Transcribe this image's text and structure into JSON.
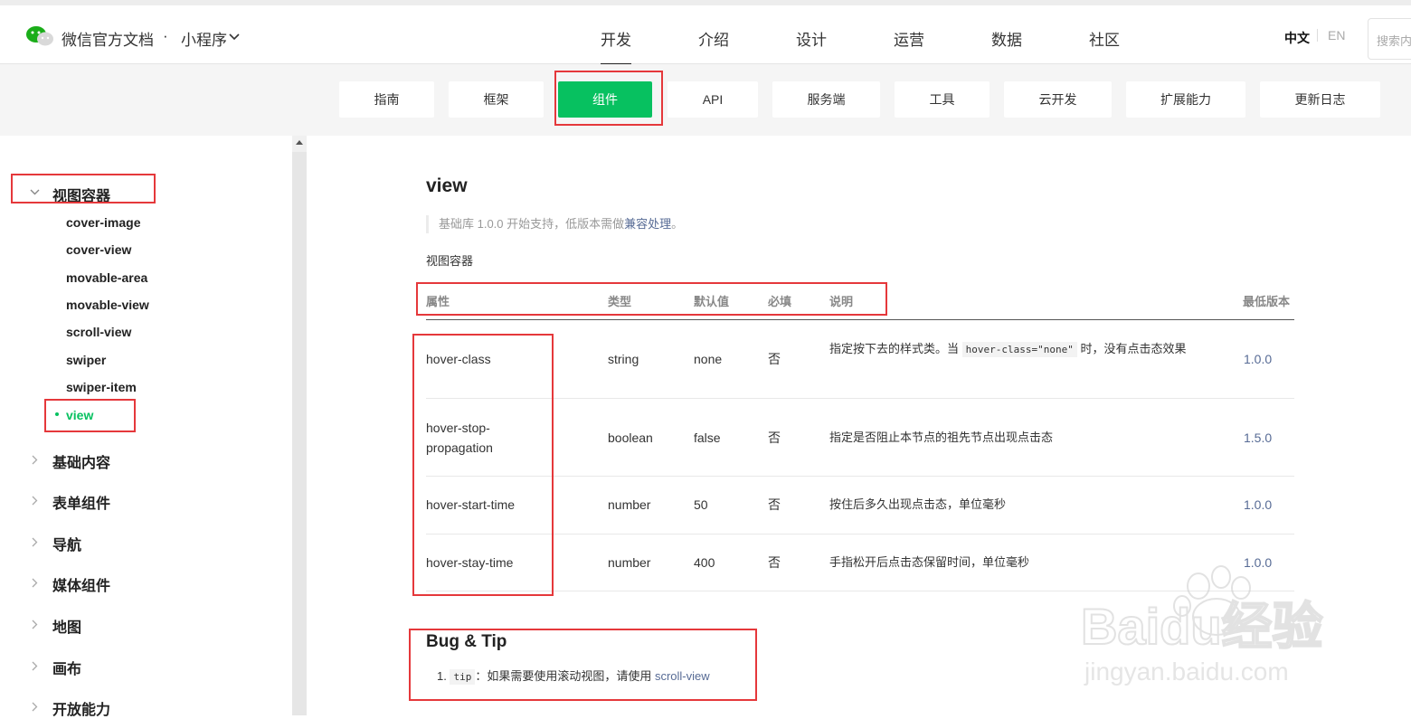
{
  "header": {
    "site_title": "微信官方文档",
    "separator": "·",
    "product": "小程序",
    "nav": [
      "开发",
      "介绍",
      "设计",
      "运营",
      "数据",
      "社区"
    ],
    "active_nav": "开发",
    "lang_zh": "中文",
    "lang_en": "EN",
    "search_placeholder": "搜索内"
  },
  "subnav": {
    "tabs": [
      "指南",
      "框架",
      "组件",
      "API",
      "服务端",
      "工具",
      "云开发",
      "扩展能力",
      "更新日志"
    ],
    "active": "组件",
    "active_color": "#07c160"
  },
  "sidebar": {
    "open_group": "视图容器",
    "items": [
      "cover-image",
      "cover-view",
      "movable-area",
      "movable-view",
      "scroll-view",
      "swiper",
      "swiper-item",
      "view"
    ],
    "active_item": "view",
    "groups": [
      "基础内容",
      "表单组件",
      "导航",
      "媒体组件",
      "地图",
      "画布",
      "开放能力"
    ]
  },
  "content": {
    "title": "view",
    "note_prefix": "基础库 1.0.0 开始支持，低版本需做",
    "note_link": "兼容处理",
    "note_suffix": "。",
    "description": "视图容器",
    "table": {
      "headers": [
        "属性",
        "类型",
        "默认值",
        "必填",
        "说明",
        "最低版本"
      ],
      "rows": [
        {
          "attr": "hover-class",
          "type": "string",
          "default": "none",
          "required": "否",
          "desc_before": "指定按下去的样式类。当 ",
          "desc_code": "hover-class=\"none\"",
          "desc_after": " 时，没有点击态效果",
          "version": "1.0.0"
        },
        {
          "attr_line1": "hover-stop-",
          "attr_line2": "propagation",
          "type": "boolean",
          "default": "false",
          "required": "否",
          "desc": "指定是否阻止本节点的祖先节点出现点击态",
          "version": "1.5.0"
        },
        {
          "attr": "hover-start-time",
          "type": "number",
          "default": "50",
          "required": "否",
          "desc": "按住后多久出现点击态，单位毫秒",
          "version": "1.0.0"
        },
        {
          "attr": "hover-stay-time",
          "type": "number",
          "default": "400",
          "required": "否",
          "desc": "手指松开后点击态保留时间，单位毫秒",
          "version": "1.0.0"
        }
      ]
    },
    "bug_title": "Bug & Tip",
    "tip_num": "1.",
    "tip_code": "tip",
    "tip_text": "：如果需要使用滚动视图，请使用 ",
    "tip_link": "scroll-view"
  },
  "watermark": {
    "brand": "Baidu经验",
    "url": "jingyan.baidu.com"
  },
  "colors": {
    "accent": "#07c160",
    "link": "#576b95",
    "annotation": "#e5383b"
  }
}
